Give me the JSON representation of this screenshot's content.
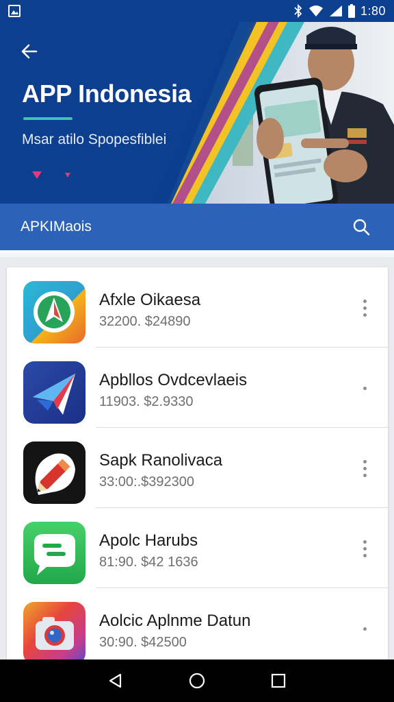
{
  "status_bar": {
    "time": "1:80",
    "icons": [
      "gallery-icon",
      "bluetooth-icon",
      "wifi-icon",
      "signal-icon",
      "battery-icon"
    ]
  },
  "header": {
    "back_icon": "arrow-left-icon",
    "title": "APP Indonesia",
    "subtitle": "Msar atilo Spopesfiblei",
    "colors": {
      "primary": "#0d3f8f",
      "accent_yellow": "#f3c326",
      "accent_teal": "#48c0b6",
      "accent_pink": "#e4397d"
    }
  },
  "search": {
    "label": "APKIMaois",
    "icon": "search-icon",
    "bar_color": "#2c62b8"
  },
  "apps": [
    {
      "name": "Afxle Oikaesa",
      "price": "32200. $24890",
      "icon": "navigation-icon"
    },
    {
      "name": "Apbllos Ovdcevlaeis",
      "price": "11903. $2.9330",
      "icon": "paper-plane-icon"
    },
    {
      "name": "Sapk Ranolivaca",
      "price": "33:00:.$392300",
      "icon": "pencil-icon"
    },
    {
      "name": "Apolc Harubs",
      "price": "81:90. $42 1636",
      "icon": "chat-icon"
    },
    {
      "name": "Aolcic Aplnme Datun",
      "price": "30:90. $42500",
      "icon": "camera-icon"
    }
  ],
  "nav": {
    "back": "back-triangle-icon",
    "home": "home-circle-icon",
    "recents": "recents-square-icon"
  }
}
